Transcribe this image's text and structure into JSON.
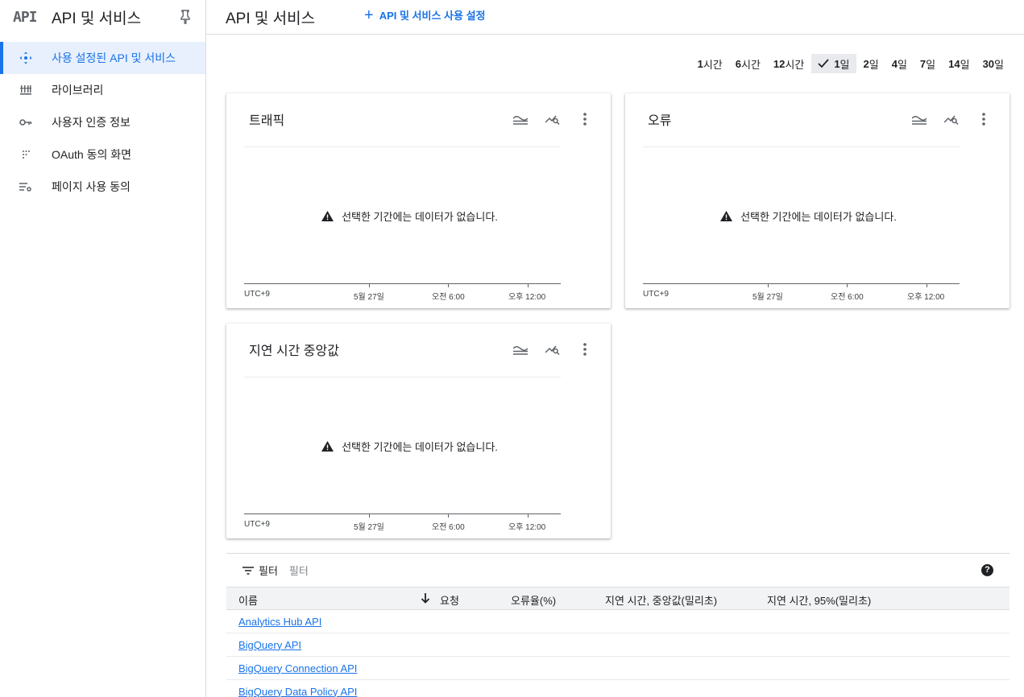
{
  "sidebar": {
    "logo": "API",
    "title": "API 및 서비스",
    "items": [
      {
        "label": "사용 설정된 API 및 서비스"
      },
      {
        "label": "라이브러리"
      },
      {
        "label": "사용자 인증 정보"
      },
      {
        "label": "OAuth 동의 화면"
      },
      {
        "label": "페이지 사용 동의"
      }
    ]
  },
  "header": {
    "title": "API 및 서비스",
    "enable_button": "API 및 서비스 사용 설정"
  },
  "time_range": {
    "options": [
      {
        "num": "1",
        "unit": "시간"
      },
      {
        "num": "6",
        "unit": "시간"
      },
      {
        "num": "12",
        "unit": "시간"
      },
      {
        "num": "1",
        "unit": "일"
      },
      {
        "num": "2",
        "unit": "일"
      },
      {
        "num": "4",
        "unit": "일"
      },
      {
        "num": "7",
        "unit": "일"
      },
      {
        "num": "14",
        "unit": "일"
      },
      {
        "num": "30",
        "unit": "일"
      }
    ],
    "selected": "1일"
  },
  "charts": {
    "empty_message": "선택한 기간에는 데이터가 없습니다.",
    "axis": {
      "tz": "UTC+9",
      "t1": "5월 27일",
      "t2": "오전 6:00",
      "t3": "오후 12:00"
    },
    "traffic": {
      "title": "트래픽"
    },
    "errors": {
      "title": "오류"
    },
    "latency": {
      "title": "지연 시간 중앙값"
    }
  },
  "table": {
    "filter_label": "필터",
    "filter_placeholder": "필터",
    "help": "?",
    "columns": {
      "name": "이름",
      "requests": "요청",
      "error_rate": "오류율(%)",
      "latency_median": "지연 시간, 중앙값(밀리초)",
      "latency_95": "지연 시간, 95%(밀리초)"
    },
    "rows": [
      {
        "name": "Analytics Hub API"
      },
      {
        "name": "BigQuery API"
      },
      {
        "name": "BigQuery Connection API"
      },
      {
        "name": "BigQuery Data Policy API"
      }
    ]
  },
  "colors": {
    "accent": "#1a73e8",
    "active_bg": "#e8f0fe",
    "divider": "#dadce0"
  }
}
